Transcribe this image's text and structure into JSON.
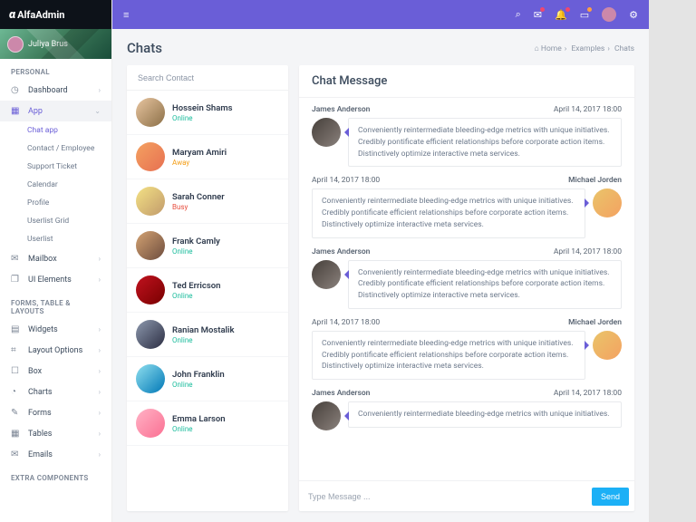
{
  "brand": "AlfaAdmin",
  "user": "Juliya Brus",
  "topbar": {
    "icons": [
      "search",
      "mail",
      "bell",
      "message",
      "avatar",
      "gear"
    ]
  },
  "page": {
    "title": "Chats"
  },
  "breadcrumb": {
    "home_icon": "home",
    "home": "Home",
    "mid": "Examples",
    "leaf": "Chats"
  },
  "nav": {
    "sections": {
      "personal": "PERSONAL",
      "forms": "FORMS, TABLE & LAYOUTS",
      "extra": "EXTRA COMPONENTS"
    },
    "items": {
      "dashboard": "Dashboard",
      "app": "App",
      "mailbox": "Mailbox",
      "ui": "UI Elements",
      "widgets": "Widgets",
      "layout": "Layout Options",
      "box": "Box",
      "charts": "Charts",
      "forms": "Forms",
      "tables": "Tables",
      "emails": "Emails"
    },
    "app_sub": {
      "chat": "Chat app",
      "contact": "Contact / Employee",
      "ticket": "Support Ticket",
      "calendar": "Calendar",
      "profile": "Profile",
      "userlist_grid": "Userlist Grid",
      "userlist": "Userlist"
    }
  },
  "search": {
    "placeholder": "Search Contact"
  },
  "contacts": [
    {
      "name": "Hossein Shams",
      "status": "Online",
      "statusClass": "st-online",
      "av": "av1"
    },
    {
      "name": "Maryam Amiri",
      "status": "Away",
      "statusClass": "st-away",
      "av": "av2"
    },
    {
      "name": "Sarah Conner",
      "status": "Busy",
      "statusClass": "st-busy",
      "av": "av3"
    },
    {
      "name": "Frank Camly",
      "status": "Online",
      "statusClass": "st-online",
      "av": "av4"
    },
    {
      "name": "Ted Erricson",
      "status": "Online",
      "statusClass": "st-online",
      "av": "av5"
    },
    {
      "name": "Ranian Mostalik",
      "status": "Online",
      "statusClass": "st-online",
      "av": "av6"
    },
    {
      "name": "John Franklin",
      "status": "Online",
      "statusClass": "st-online",
      "av": "av7"
    },
    {
      "name": "Emma Larson",
      "status": "Online",
      "statusClass": "st-online",
      "av": "av8"
    }
  ],
  "chat": {
    "header": "Chat Message",
    "messages": [
      {
        "who": "James Anderson",
        "time": "April 14, 2017 18:00",
        "side": "left",
        "av": "avJ",
        "text": "Conveniently reintermediate bleeding-edge metrics with unique initiatives. Credibly pontificate efficient relationships before corporate action items. Distinctively optimize interactive meta services."
      },
      {
        "who": "Michael Jorden",
        "time": "April 14, 2017 18:00",
        "side": "right",
        "av": "avM",
        "text": "Conveniently reintermediate bleeding-edge metrics with unique initiatives. Credibly pontificate efficient relationships before corporate action items. Distinctively optimize interactive meta services."
      },
      {
        "who": "James Anderson",
        "time": "April 14, 2017 18:00",
        "side": "left",
        "av": "avJ",
        "text": "Conveniently reintermediate bleeding-edge metrics with unique initiatives. Credibly pontificate efficient relationships before corporate action items. Distinctively optimize interactive meta services."
      },
      {
        "who": "Michael Jorden",
        "time": "April 14, 2017 18:00",
        "side": "right",
        "av": "avM",
        "text": "Conveniently reintermediate bleeding-edge metrics with unique initiatives. Credibly pontificate efficient relationships before corporate action items. Distinctively optimize interactive meta services."
      },
      {
        "who": "James Anderson",
        "time": "April 14, 2017 18:00",
        "side": "left",
        "av": "avJ",
        "text": "Conveniently reintermediate bleeding-edge metrics with unique initiatives."
      }
    ],
    "compose": {
      "placeholder": "Type Message ...",
      "send": "Send"
    }
  }
}
